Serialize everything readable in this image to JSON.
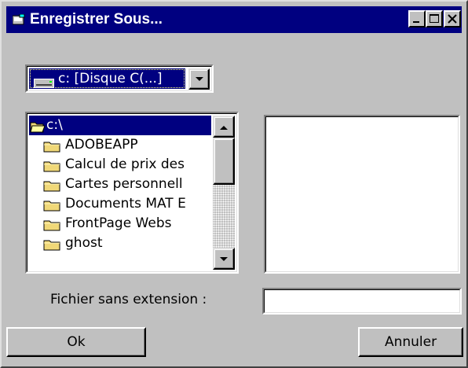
{
  "window": {
    "title": "Enregistrer Sous...",
    "icon": "save-dialog-icon",
    "controls": [
      "minimize-icon",
      "maximize-icon",
      "close-icon"
    ]
  },
  "drive": {
    "selected": "c: [Disque C(...]",
    "icon": "hard-drive-icon"
  },
  "folders": {
    "root": "c:\\",
    "items": [
      "ADOBEAPP",
      "Calcul de prix des",
      "Cartes personnell",
      "Documents MAT E",
      "FrontPage Webs",
      "ghost"
    ]
  },
  "file_list": {
    "items": []
  },
  "filename": {
    "label": "Fichier sans extension :",
    "value": ""
  },
  "buttons": {
    "ok": "Ok",
    "cancel": "Annuler"
  },
  "colors": {
    "titlebar": "#000080",
    "window": "#c0c0c0",
    "selection": "#000080",
    "folder": "#f0d878"
  }
}
